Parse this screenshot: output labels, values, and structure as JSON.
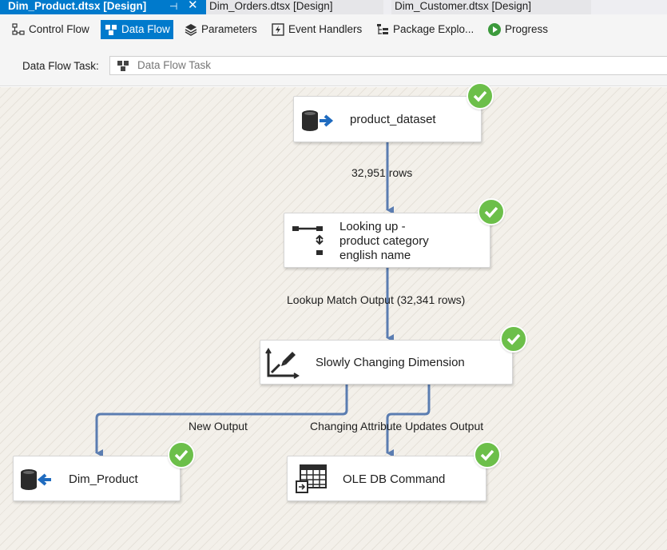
{
  "tabs": [
    {
      "label": "Dim_Product.dtsx [Design]",
      "active": true
    },
    {
      "label": "Dim_Orders.dtsx [Design]",
      "active": false
    },
    {
      "label": "Dim_Customer.dtsx [Design]",
      "active": false
    }
  ],
  "toolbar": {
    "control_flow": "Control Flow",
    "data_flow": "Data Flow",
    "parameters": "Parameters",
    "event_handlers": "Event Handlers",
    "package_explorer": "Package Explo...",
    "progress": "Progress",
    "selected": "Data Flow"
  },
  "task": {
    "label": "Data Flow Task:",
    "value": "Data Flow Task"
  },
  "nodes": {
    "source": {
      "label": "product_dataset",
      "status": "success"
    },
    "lookup": {
      "label": "Looking up -\nproduct category\nenglish name",
      "status": "success"
    },
    "scd": {
      "label": "Slowly Changing Dimension",
      "status": "success"
    },
    "dest": {
      "label": "Dim_Product",
      "status": "success"
    },
    "oledb": {
      "label": "OLE DB Command",
      "status": "success"
    }
  },
  "flows": {
    "source_to_lookup": "32,951 rows",
    "lookup_to_scd": "Lookup Match Output (32,341 rows)",
    "scd_to_dest": "New Output",
    "scd_to_oledb": "Changing Attribute Updates Output"
  },
  "colors": {
    "accent": "#007acc",
    "success": "#6cbf4a",
    "flow_line": "#5b7db1"
  }
}
